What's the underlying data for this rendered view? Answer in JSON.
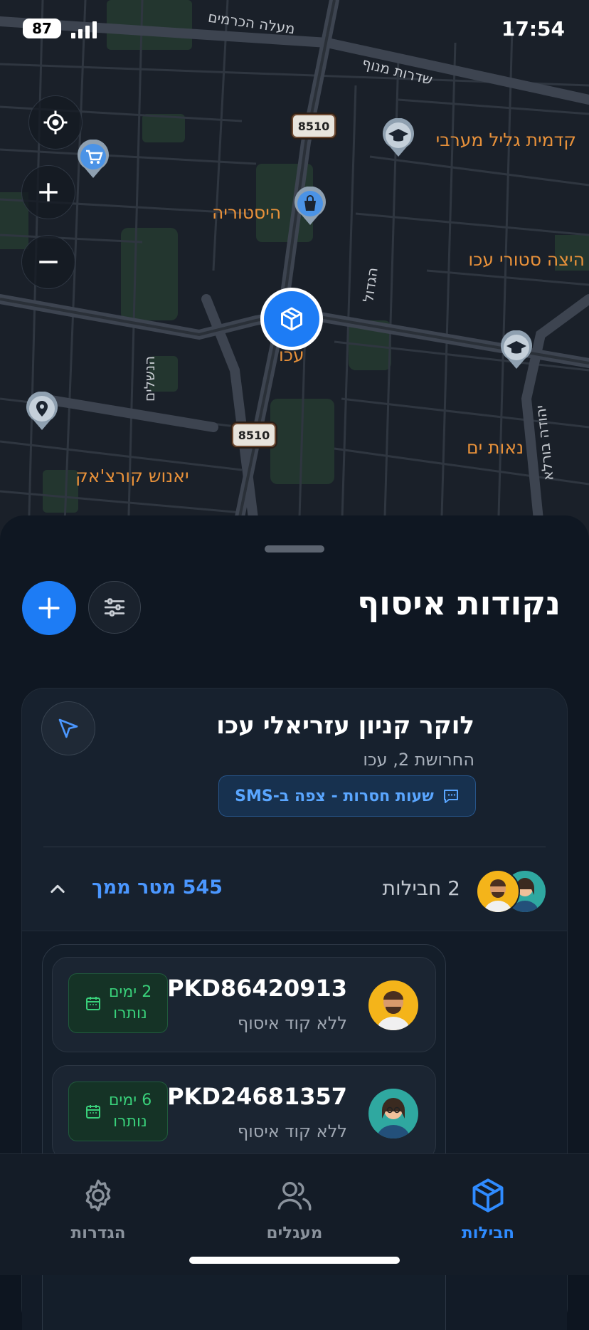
{
  "status_bar": {
    "time": "17:54",
    "battery": "87"
  },
  "map": {
    "streets": [
      "מעלה הכרמים",
      "שדרות מנוף",
      "הגדול",
      "הנשלים",
      "יהודה בורלא"
    ],
    "poi_labels": [
      "קדמית גליל מערבי",
      "היסטוריה",
      "היצה סטורי עכו",
      "עכו",
      "נאות ים",
      "יאנוש קורצ'אק"
    ],
    "route_number": "8510",
    "icons": [
      "location-target-icon",
      "zoom-in-icon",
      "zoom-out-icon",
      "cart-pin-icon",
      "bag-pin-icon",
      "graduation-pin-icon",
      "box-marker-icon"
    ]
  },
  "sheet": {
    "title": "נקודות איסוף",
    "card": {
      "title": "לוקר קניון עזריאלי עכו",
      "address": "החרושת 2, עכו",
      "hours_note": "שעות חסרות - צפה ב-SMS",
      "package_count": "2 חבילות",
      "distance": "545 מטר ממך",
      "packages": [
        {
          "id": "PKD86420913",
          "note": "ללא קוד איסוף",
          "days_line1": "2 ימים",
          "days_line2": "נותרו"
        },
        {
          "id": "PKD24681357",
          "note": "ללא קוד איסוף",
          "days_line1": "6 ימים",
          "days_line2": "נותרו"
        }
      ]
    }
  },
  "tabs": [
    {
      "label": "הגדרות",
      "icon": "gear-icon",
      "active": false
    },
    {
      "label": "מעגלים",
      "icon": "users-icon",
      "active": false
    },
    {
      "label": "חבילות",
      "icon": "box-icon",
      "active": true
    }
  ],
  "colors": {
    "accent": "#1d7cf5",
    "success": "#39d07a",
    "map_label": "#e8913a"
  }
}
